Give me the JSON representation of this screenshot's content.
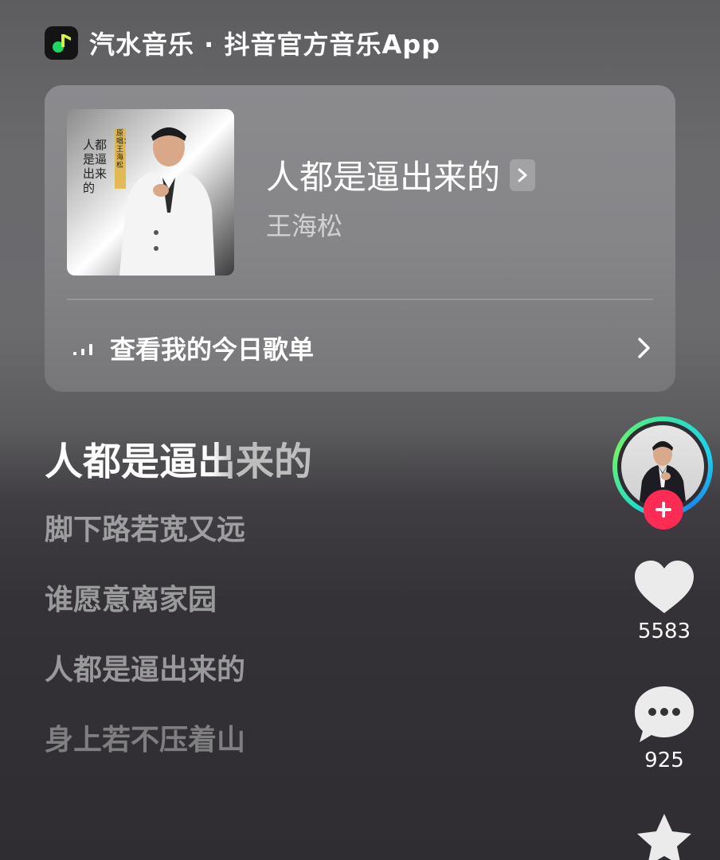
{
  "header": {
    "app_icon": "music-note-icon",
    "title": "汽水音乐 · 抖音官方音乐App"
  },
  "song_card": {
    "title": "人都是逼出来的",
    "artist": "王海松",
    "cover_text": {
      "title_vertical": "人都是逼出来的",
      "credit": "原唱：王海松"
    },
    "playlist_label": "查看我的今日歌单"
  },
  "lyrics": {
    "current": "人都是逼出来的",
    "lines": [
      "脚下路若宽又远",
      "谁愿意离家园",
      "人都是逼出来的",
      "身上若不压着山"
    ]
  },
  "actions": {
    "like_count": "5583",
    "comment_count": "925"
  },
  "colors": {
    "accent": "#fe2c55",
    "logo_green": "#1ed760",
    "logo_yellow": "#d7f23a"
  }
}
